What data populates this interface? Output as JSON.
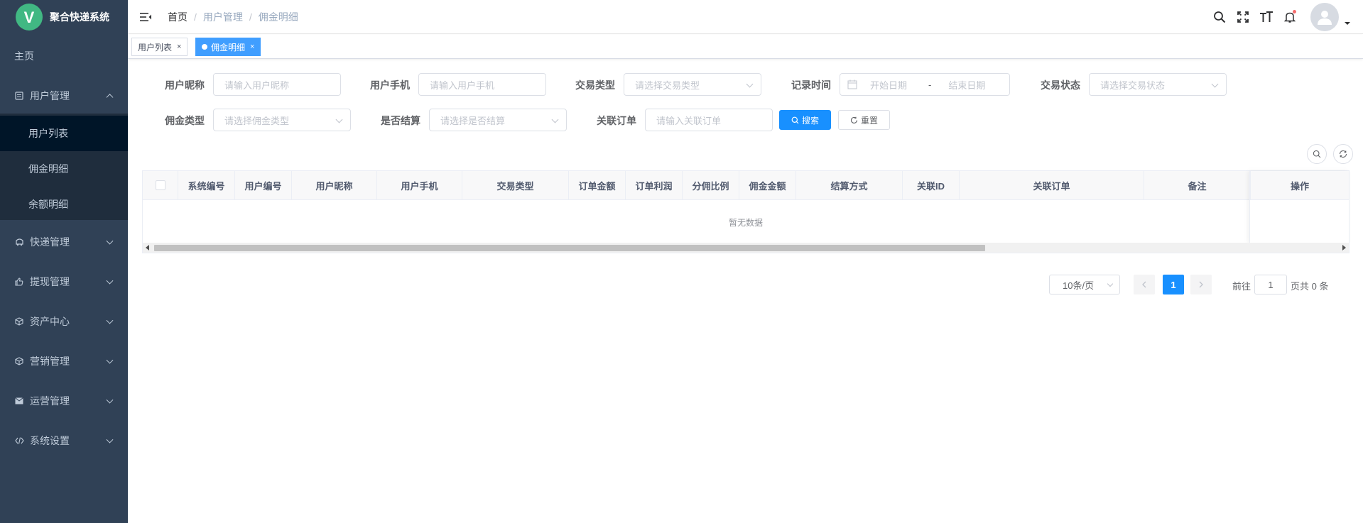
{
  "sidebar": {
    "app_title": "聚合快递系统",
    "logo_letter": "V",
    "items": [
      {
        "label": "主页"
      },
      {
        "label": "用户管理",
        "icon": "list-icon"
      },
      {
        "label": "快递管理",
        "icon": "truck-icon"
      },
      {
        "label": "提现管理",
        "icon": "thumb-icon"
      },
      {
        "label": "资产中心",
        "icon": "cube-icon"
      },
      {
        "label": "营销管理",
        "icon": "cube-icon"
      },
      {
        "label": "运营管理",
        "icon": "mail-icon"
      },
      {
        "label": "系统设置",
        "icon": "code-icon"
      }
    ],
    "sub_items": [
      {
        "label": "用户列表"
      },
      {
        "label": "佣金明细"
      },
      {
        "label": "余额明细"
      }
    ]
  },
  "header": {
    "breadcrumb": [
      "首页",
      "用户管理",
      "佣金明细"
    ],
    "separator": "/"
  },
  "tags": [
    {
      "label": "用户列表",
      "close": "×"
    },
    {
      "label": "佣金明细",
      "close": "×"
    }
  ],
  "search": {
    "nickname_label": "用户昵称",
    "nickname_ph": "请输入用户昵称",
    "phone_label": "用户手机",
    "phone_ph": "请输入用户手机",
    "trade_type_label": "交易类型",
    "trade_type_ph": "请选择交易类型",
    "record_time_label": "记录时间",
    "start_date_ph": "开始日期",
    "date_sep": "-",
    "end_date_ph": "结束日期",
    "trade_status_label": "交易状态",
    "trade_status_ph": "请选择交易状态",
    "commission_type_label": "佣金类型",
    "commission_type_ph": "请选择佣金类型",
    "settled_label": "是否结算",
    "settled_ph": "请选择是否结算",
    "order_label": "关联订单",
    "order_ph": "请输入关联订单",
    "search_btn": "搜索",
    "reset_btn": "重置"
  },
  "table": {
    "columns": [
      "系统编号",
      "用户编号",
      "用户昵称",
      "用户手机",
      "交易类型",
      "订单金额",
      "订单利润",
      "分佣比例",
      "佣金金额",
      "结算方式",
      "关联ID",
      "关联订单",
      "备注",
      "操作"
    ],
    "empty_text": "暂无数据"
  },
  "pagination": {
    "page_size": "10条/页",
    "current_page": "1",
    "goto_label": "前往",
    "goto_value": "1",
    "total_text": "页共 0 条"
  },
  "colors": {
    "sidebar_bg": "#304156",
    "primary": "#1890ff",
    "tag_active": "#409eff"
  }
}
